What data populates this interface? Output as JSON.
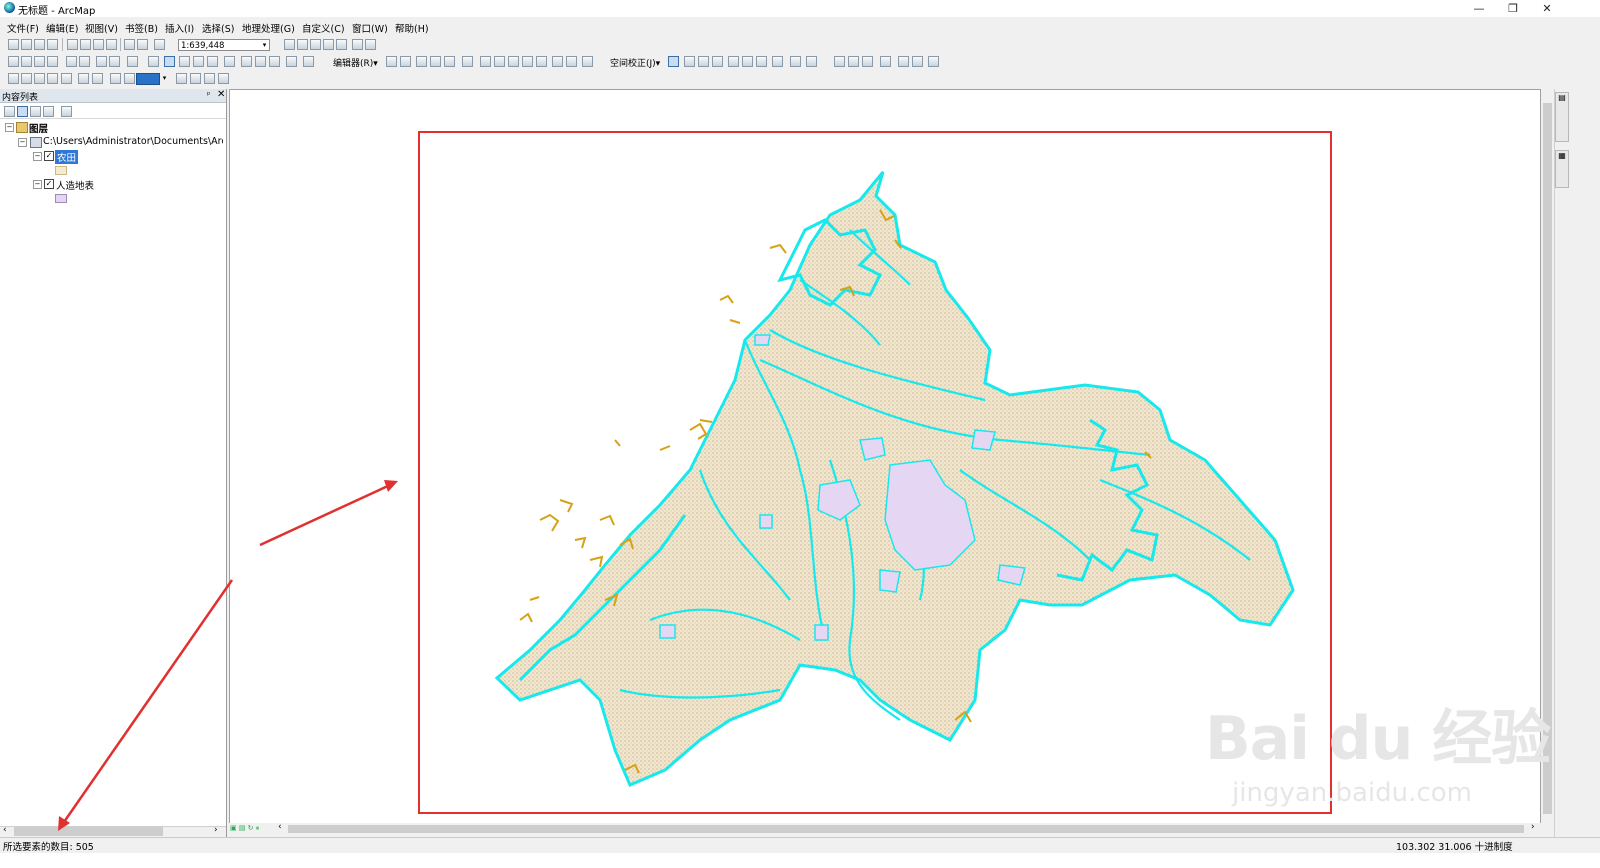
{
  "window": {
    "title": "无标题 - ArcMap",
    "minimize": "—",
    "maximize": "❐",
    "close": "✕"
  },
  "menu": [
    "文件(F)",
    "编辑(E)",
    "视图(V)",
    "书签(B)",
    "插入(I)",
    "选择(S)",
    "地理处理(G)",
    "自定义(C)",
    "窗口(W)",
    "帮助(H)"
  ],
  "toolbar": {
    "scale": "1:639,448",
    "editor_label": "编辑器(R)▾",
    "georef_label": "空间校正(J)▾"
  },
  "toc": {
    "title": "内容列表",
    "pin": "ᵖ",
    "close": "✕",
    "root": "图层",
    "path": "C:\\Users\\Administrator\\Documents\\ArcGIS",
    "layers": [
      {
        "name": "农田",
        "checked": true,
        "selected": true,
        "swatch": "#f4ebd0"
      },
      {
        "name": "人造地表",
        "checked": true,
        "selected": false,
        "swatch": "#e5d5f5"
      }
    ]
  },
  "colors": {
    "farmland_fill": "#f1e7d0",
    "water_outline": "#17e8ec",
    "builtup_fill": "#e5d6f3",
    "edge_yellow": "#d6a215",
    "frame_red": "#e03030",
    "arrow_red": "#e03030",
    "selected_bg": "#3078d8"
  },
  "status": {
    "selected_count": "所选要素的数目: 505",
    "coords": "103.302  31.006 十进制度"
  },
  "watermark": {
    "main": "Bai du 经验",
    "sub": "jingyan.baidu.com"
  }
}
